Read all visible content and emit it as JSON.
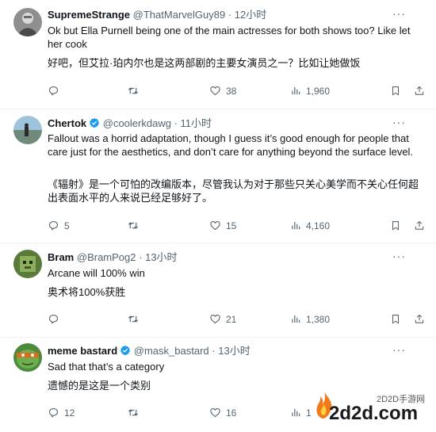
{
  "tweets": [
    {
      "name": "SupremeStrange",
      "handle": "@ThatMarvelGuy89",
      "time": "12小时",
      "verified": false,
      "text": "Ok but Ella Purnell being one of the main actresses for both shows too? Like let her cook",
      "translation": "好吧，但艾拉·珀内尔也是这两部剧的主要女演员之一？比如让她做饭",
      "replies": "",
      "retweets": "",
      "likes": "38",
      "views": "1,960"
    },
    {
      "name": "Chertok",
      "handle": "@coolerkdawg",
      "time": "11小时",
      "verified": true,
      "text": "Fallout was a horrid adaptation, though I guess it’s good enough for people that care just for the aesthetics, and don’t care for anything beyond the surface level.",
      "translation": "《辐射》是一个可怕的改编版本，尽管我认为对于那些只关心美学而不关心任何超出表面水平的人来说已经足够好了。",
      "replies": "5",
      "retweets": "",
      "likes": "15",
      "views": "4,160"
    },
    {
      "name": "Bram",
      "handle": "@BramPog2",
      "time": "13小时",
      "verified": false,
      "text": "Arcane will 100% win",
      "translation": "奥术将100%获胜",
      "replies": "",
      "retweets": "",
      "likes": "21",
      "views": "1,380"
    },
    {
      "name": "meme bastard",
      "handle": "@mask_bastard",
      "time": "13小时",
      "verified": true,
      "text": "Sad that that’s a category",
      "translation": "遗憾的是这是一个类别",
      "replies": "12",
      "retweets": "",
      "likes": "16",
      "views": "1"
    }
  ],
  "separator": "·",
  "more_label": "···",
  "watermark": {
    "small": "2D2D手游网",
    "big": "2d2d.com"
  },
  "colors": {
    "verified": "#1d9bf0",
    "text": "#0f1419",
    "muted": "#536471",
    "divider": "#eff3f4"
  },
  "icons": [
    "reply-icon",
    "retweet-icon",
    "like-icon",
    "views-icon",
    "bookmark-icon",
    "share-icon",
    "more-icon",
    "verified-icon"
  ]
}
